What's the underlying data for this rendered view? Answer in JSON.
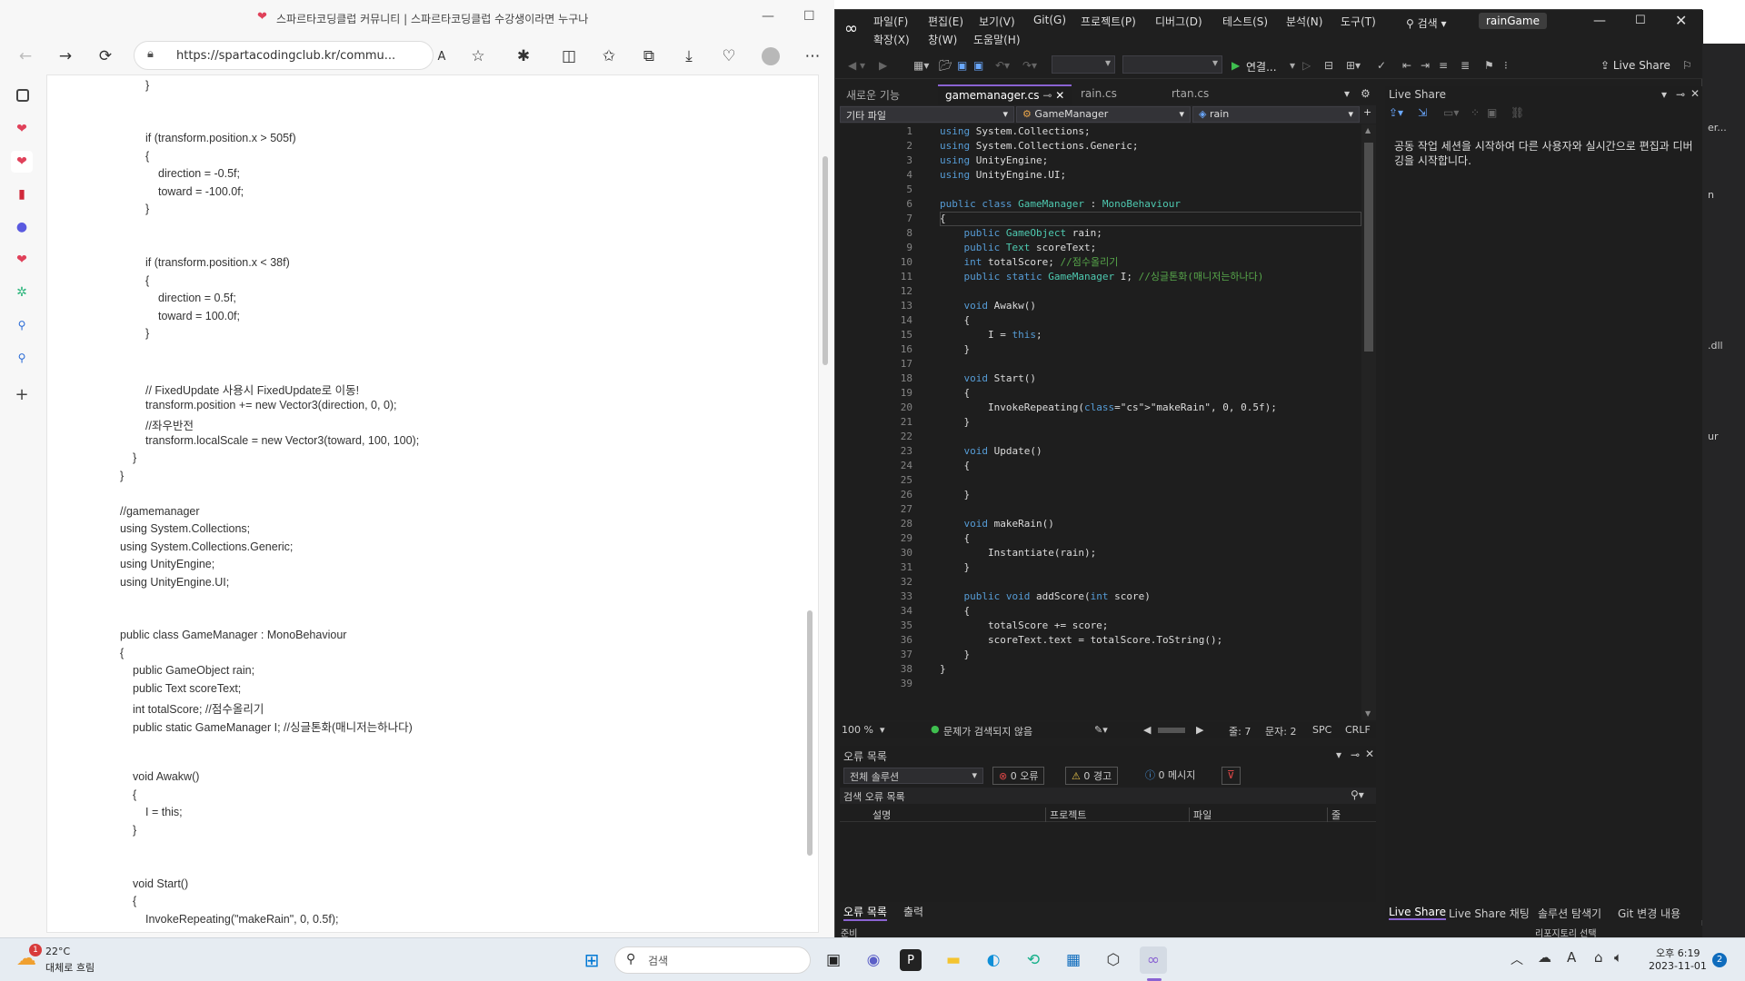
{
  "browser": {
    "title": "스파르타코딩클럽 커뮤니티 | 스파르타코딩클럽 수강생이라면 누구나",
    "url": "https://spartacodingclub.kr/commu...",
    "page_lines": [
      "}",
      "if (transform.position.x > 505f)",
      "{",
      "direction = -0.5f;",
      "toward = -100.0f;",
      "}",
      "if (transform.position.x < 38f)",
      "{",
      "direction = 0.5f;",
      "toward = 100.0f;",
      "}",
      "// FixedUpdate 사용시 FixedUpdate로 이동!",
      "transform.position += new Vector3(direction, 0, 0);",
      "//좌우반전",
      "transform.localScale = new Vector3(toward, 100, 100);",
      "}",
      "}",
      "//gamemanager",
      "using System.Collections;",
      "using System.Collections.Generic;",
      "using UnityEngine;",
      "using UnityEngine.UI;",
      "public class GameManager : MonoBehaviour",
      "{",
      "public GameObject rain;",
      "public Text scoreText;",
      "int totalScore; //점수올리기",
      "public static GameManager I; //싱글톤화(매니저는하나다)",
      "void Awakw()",
      "{",
      "I = this;",
      "}",
      "void Start()",
      "{",
      "InvokeRepeating(\"makeRain\", 0, 0.5f);"
    ]
  },
  "vs": {
    "menu": [
      "파일(F)",
      "편집(E)",
      "보기(V)",
      "Git(G)",
      "프로젝트(P)",
      "디버그(D)",
      "테스트(S)",
      "분석(N)",
      "도구(T)",
      "확장(X)",
      "창(W)",
      "도움말(H)"
    ],
    "search": "검색",
    "project": "rainGame",
    "run_label": "연결...",
    "liveshare_btn": "Live Share",
    "tabs": [
      "새로운 기능",
      "gamemanager.cs",
      "rain.cs",
      "rtan.cs"
    ],
    "nav": [
      "기타 파일",
      "GameManager",
      "rain"
    ],
    "line_numbers": [
      "1",
      "2",
      "3",
      "4",
      "5",
      "6",
      "7",
      "8",
      "9",
      "10",
      "11",
      "12",
      "13",
      "14",
      "15",
      "16",
      "17",
      "18",
      "19",
      "20",
      "21",
      "22",
      "23",
      "24",
      "25",
      "26",
      "27",
      "28",
      "29",
      "30",
      "31",
      "32",
      "33",
      "34",
      "35",
      "36",
      "37",
      "38",
      "39"
    ],
    "code": [
      "using System.Collections;",
      "using System.Collections.Generic;",
      "using UnityEngine;",
      "using UnityEngine.UI;",
      "",
      "public class GameManager : MonoBehaviour",
      "{",
      "    public GameObject rain;",
      "    public Text scoreText;",
      "    int totalScore; //점수올리기",
      "    public static GameManager I; //싱글톤화(매니저는하나다)",
      "",
      "    void Awakw()",
      "    {",
      "        I = this;",
      "    }",
      "",
      "    void Start()",
      "    {",
      "        InvokeRepeating(\"makeRain\", 0, 0.5f);",
      "    }",
      "",
      "    void Update()",
      "    {",
      "",
      "    }",
      "",
      "    void makeRain()",
      "    {",
      "        Instantiate(rain);",
      "    }",
      "",
      "    public void addScore(int score)",
      "    {",
      "        totalScore += score;",
      "        scoreText.text = totalScore.ToString();",
      "    }",
      "}",
      ""
    ],
    "status": {
      "zoom": "100 %",
      "issues": "문제가 검색되지 않음",
      "line": "줄: 7",
      "col": "문자: 2",
      "spc": "SPC",
      "crlf": "CRLF"
    },
    "errors": {
      "title": "오류 목록",
      "scope": "전체 솔루션",
      "err": "0 오류",
      "warn": "0 경고",
      "msg": "0 메시지",
      "search": "검색 오류 목록",
      "cols": [
        "설명",
        "프로젝트",
        "파일",
        "줄"
      ],
      "bottom_tabs": [
        "오류 목록",
        "출력"
      ]
    },
    "liveshare": {
      "title": "Live Share",
      "text": "공동 작업 세션을 시작하여 다른 사용자와 실시간으로 편집과 디버깅을 시작합니다.",
      "bottom_tabs": [
        "Live Share",
        "Live Share 채팅",
        "솔루션 탐색기",
        "Git 변경 내용"
      ]
    },
    "statusbar": {
      "left": "준비",
      "right": "리포지토리 선택"
    }
  },
  "sliver": {
    "a": "er...",
    "b": "n",
    "c": ".dll",
    "d": "ur"
  },
  "taskbar": {
    "temp": "22°C",
    "weather": "대체로 흐림",
    "badge": "1",
    "search": "검색",
    "time": "오후 6:19",
    "date": "2023-11-01",
    "notif": "2"
  },
  "colors": {
    "vs_accent": "#8a63d2",
    "accent_blue": "#0078d4"
  }
}
